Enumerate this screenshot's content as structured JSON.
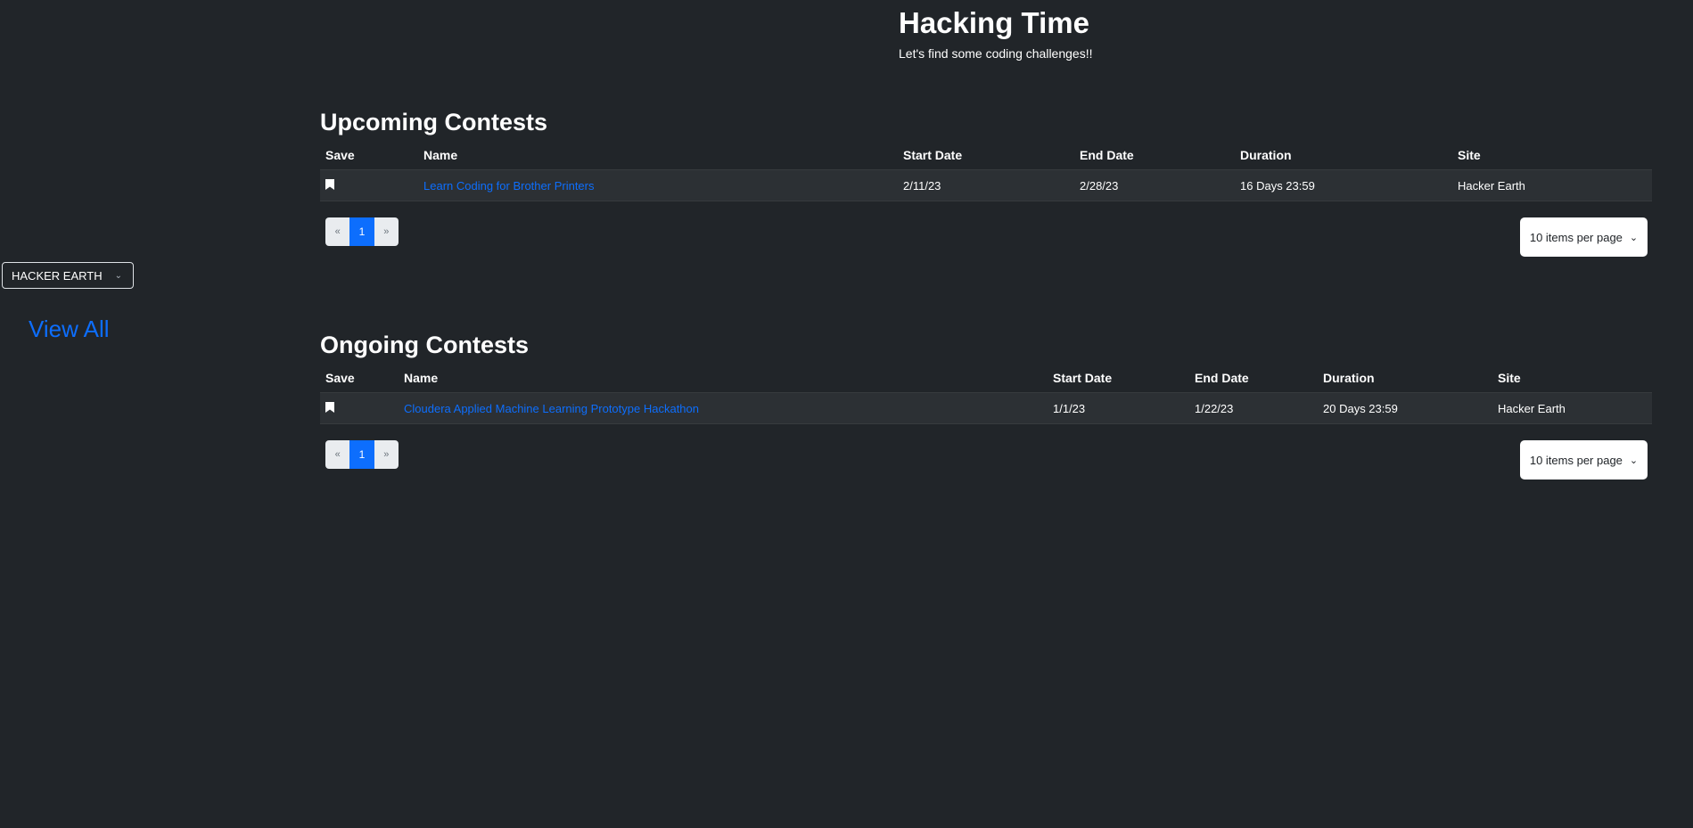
{
  "header": {
    "title": "Hacking Time",
    "subtitle": "Let's find some coding challenges!!"
  },
  "sidebar": {
    "site_select_value": "HACKER EARTH",
    "view_all_label": "View All"
  },
  "upcoming": {
    "title": "Upcoming Contests",
    "columns": [
      "Save",
      "Name",
      "Start Date",
      "End Date",
      "Duration",
      "Site"
    ],
    "rows": [
      {
        "name": "Learn Coding for Brother Printers",
        "start": "2/11/23",
        "end": "2/28/23",
        "duration": "16 Days 23:59",
        "site": "Hacker Earth"
      }
    ],
    "pager": {
      "prev": "«",
      "page": "1",
      "next": "»"
    },
    "per_page": "10 items per page"
  },
  "ongoing": {
    "title": "Ongoing Contests",
    "columns": [
      "Save",
      "Name",
      "Start Date",
      "End Date",
      "Duration",
      "Site"
    ],
    "rows": [
      {
        "name": "Cloudera Applied Machine Learning Prototype Hackathon",
        "start": "1/1/23",
        "end": "1/22/23",
        "duration": "20 Days 23:59",
        "site": "Hacker Earth"
      }
    ],
    "pager": {
      "prev": "«",
      "page": "1",
      "next": "»"
    },
    "per_page": "10 items per page"
  },
  "icons": {
    "bookmark": "bookmark-icon",
    "chevron": "chevron-down-icon"
  }
}
